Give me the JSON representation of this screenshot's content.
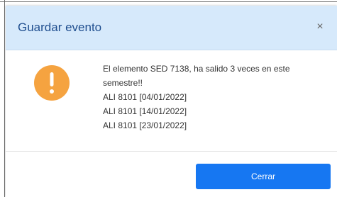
{
  "dialog": {
    "title": "Guardar evento",
    "close_glyph": "×",
    "close_icon": "close-icon",
    "warning_icon": "exclamation-warning-icon",
    "warning_icon_glyph": "!",
    "message_lines": [
      "El elemento SED 7138, ha salido 3 veces en este",
      "semestre!!",
      "ALI 8101 [04/01/2022]",
      "ALI 8101 [14/01/2022]",
      "ALI 8101 [23/01/2022]"
    ],
    "primary_button_label": "Cerrar"
  },
  "colors": {
    "header_bg": "#d6e9fb",
    "title_text": "#1f4e8f",
    "warning_orange": "#f5a340",
    "primary_button": "#1677f2"
  }
}
